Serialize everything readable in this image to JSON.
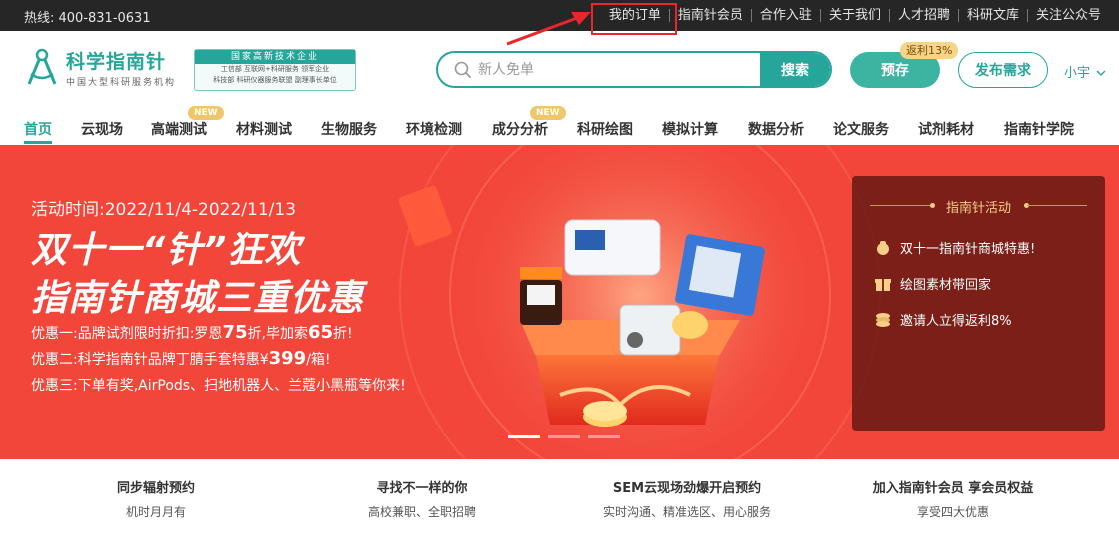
{
  "topbar": {
    "hotline": "热线: 400-831-0631",
    "links": [
      "我的订单",
      "指南针会员",
      "合作入驻",
      "关于我们",
      "人才招聘",
      "科研文库",
      "关注公众号"
    ]
  },
  "header": {
    "logo_title": "科学指南针",
    "logo_sub": "中国大型科研服务机构",
    "cert_head": "国家高新技术企业",
    "cert_line1": "工信部 互联网+科研服务 领军企业",
    "cert_line2": "科技部 科研仪器服务联盟 副理事长单位",
    "search_placeholder": "新人免单",
    "search_button": "搜索",
    "reserve_button": "预存",
    "rebate_badge": "返利13%",
    "post_button": "发布需求",
    "user_name": "小宇"
  },
  "nav": {
    "items": [
      "首页",
      "云现场",
      "高端测试",
      "材料测试",
      "生物服务",
      "环境检测",
      "成分分析",
      "科研绘图",
      "模拟计算",
      "数据分析",
      "论文服务",
      "试剂耗材",
      "指南针学院"
    ],
    "new_badge": "NEW"
  },
  "banner": {
    "time": "活动时间:2022/11/4-2022/11/13",
    "title1": "双十一“针”狂欢",
    "title2": "指南针商城三重优惠",
    "offer1_a": "优惠一:品牌试剂限时折扣:罗恩",
    "offer1_b": "75",
    "offer1_c": "折,毕加索",
    "offer1_d": "65",
    "offer1_e": "折!",
    "offer2_a": "优惠二:科学指南针品牌丁腈手套特惠¥",
    "offer2_b": "399",
    "offer2_c": "/箱!",
    "offer3": "优惠三:下单有奖,AirPods、扫地机器人、兰蔻小黑瓶等你来!",
    "panel_title": "指南针活动",
    "panel_items": [
      "双十一指南针商城特惠!",
      "绘图素材带回家",
      "邀请人立得返利8%"
    ]
  },
  "promos": [
    {
      "title": "同步辐射预约",
      "sub": "机时月月有"
    },
    {
      "title": "寻找不一样的你",
      "sub": "高校兼职、全职招聘"
    },
    {
      "title": "SEM云现场劲爆开启预约",
      "sub": "实时沟通、精准选区、用心服务"
    },
    {
      "title": "加入指南针会员 享会员权益",
      "sub": "享受四大优惠"
    }
  ],
  "colors": {
    "brand": "#26a69a",
    "topbar_bg": "#262626",
    "banner_bg": "#f2463a",
    "highlight": "#e8262b",
    "badge_gold": "#f0c66a"
  }
}
